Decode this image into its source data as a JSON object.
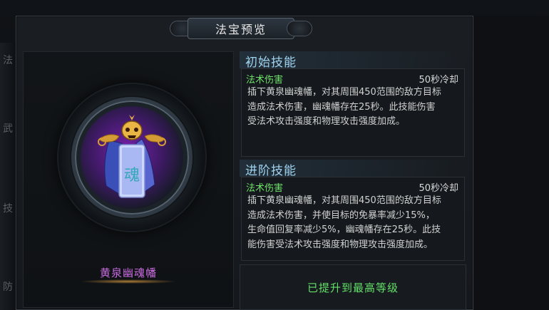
{
  "window": {
    "title": "法宝预览"
  },
  "side": {
    "chars": [
      "法",
      "武",
      "技",
      "防"
    ]
  },
  "item": {
    "name": "黄泉幽魂幡",
    "banner_glyph": "魂",
    "icon": "skull-banner-icon"
  },
  "initial_skill": {
    "section_title": "初始技能",
    "type": "法术伤害",
    "cooldown": "50秒冷却",
    "lines": [
      "插下黄泉幽魂幡，对其周围450范围的敌方目标",
      "造成法术伤害，幽魂幡存在25秒。此技能伤害",
      "受法术攻击强度和物理攻击强度加成。"
    ]
  },
  "advanced_skill": {
    "section_title": "进阶技能",
    "type": "法术伤害",
    "cooldown": "50秒冷却",
    "lines": [
      "插下黄泉幽魂幡，对其周围450范围的敌方目标",
      "造成法术伤害，并使目标的免暴率减少15%，",
      "生命值回复率减少5%，幽魂幡存在25秒。此技",
      "能伤害受法术攻击强度和物理攻击强度加成。"
    ]
  },
  "status": {
    "max_level": "已提升到最高等级"
  },
  "colors": {
    "section_title": "#9fd3ef",
    "skill_type": "#6fe36a",
    "item_name": "#c86bde",
    "max_level": "#62e067"
  }
}
